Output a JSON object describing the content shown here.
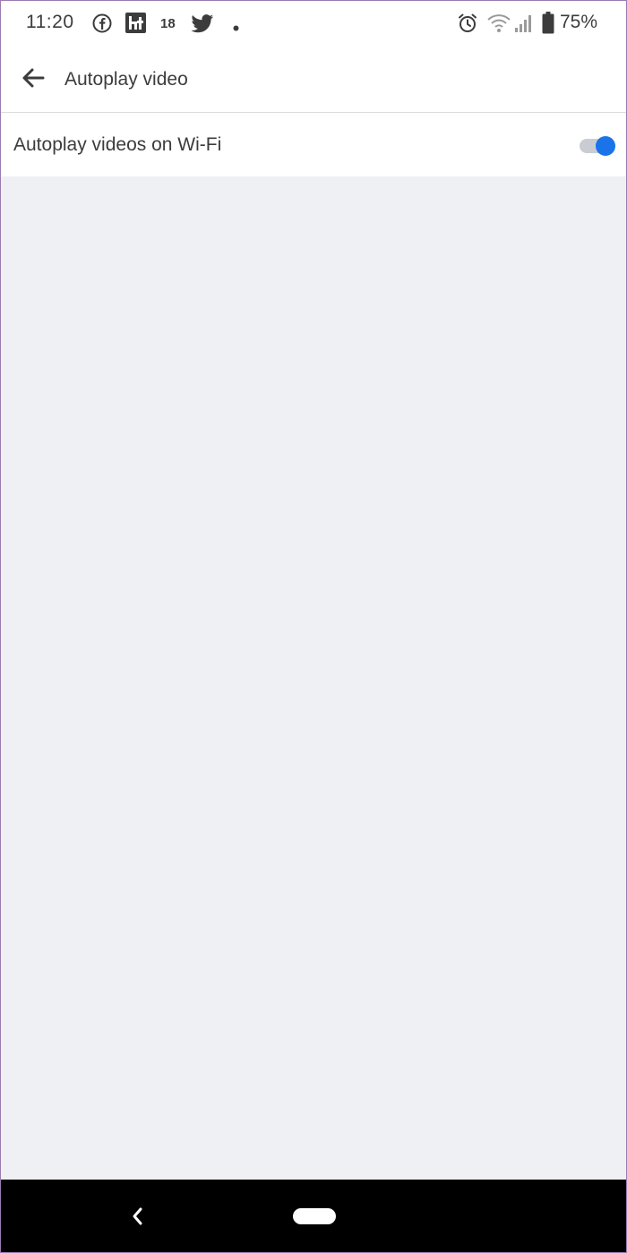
{
  "status_bar": {
    "time": "11:20",
    "notification_count": "18",
    "battery": "75%",
    "icons": [
      "facebook-icon",
      "ht-app-icon",
      "twitter-icon",
      "more-dot-icon",
      "alarm-icon",
      "wifi-icon",
      "signal-icon",
      "battery-icon"
    ]
  },
  "app_bar": {
    "title": "Autoplay video",
    "back_icon": "arrow-back-icon"
  },
  "settings": {
    "autoplay_wifi_label": "Autoplay videos on Wi-Fi",
    "autoplay_wifi_enabled": true
  },
  "colors": {
    "accent": "#1a73e8",
    "background": "#eff0f4",
    "surface": "#ffffff",
    "nav_bar": "#000000"
  },
  "nav_bar": {
    "icons": [
      "nav-back-icon",
      "nav-home-pill"
    ]
  }
}
